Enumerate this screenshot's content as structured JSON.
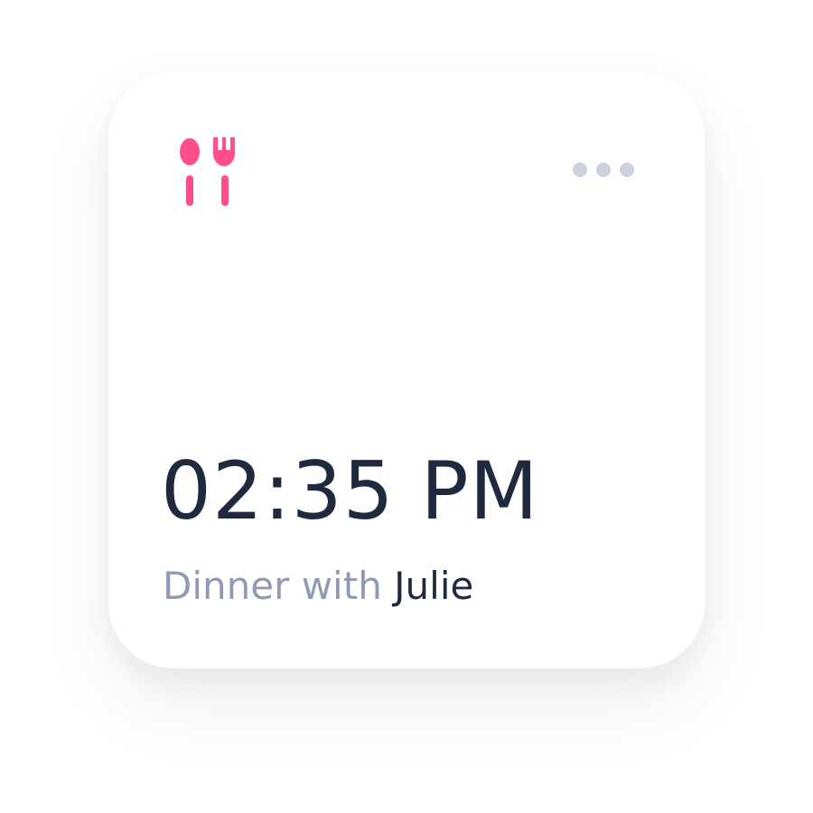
{
  "card": {
    "icon": "fork-and-spoon-icon",
    "menu_icon": "more-horizontal-icon",
    "time": "02:35 PM",
    "caption_prefix": "Dinner with",
    "caption_name": "Julie"
  },
  "colors": {
    "accent": "#ff4f8b",
    "menu_dots": "#cbd1de",
    "text_primary": "#1f2a3f",
    "text_muted": "#8f9bb2"
  }
}
